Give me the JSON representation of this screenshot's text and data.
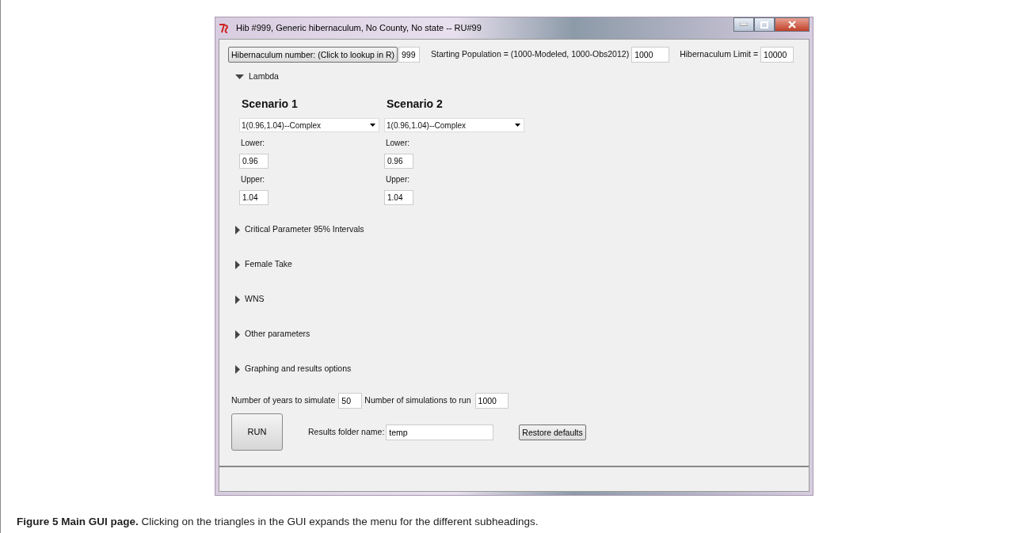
{
  "window": {
    "title": "Hib #999, Generic hibernaculum, No County, No state -- RU#99"
  },
  "top_bar": {
    "lookup_button": "Hibernaculum number: (Click to lookup in R)",
    "hib_number": "999",
    "population_label": "Starting Population = (1000-Modeled,  1000-Obs2012)",
    "population_value": "1000",
    "limit_label": "Hibernaculum Limit =",
    "limit_value": "10000"
  },
  "sections": [
    {
      "label": "Lambda",
      "expanded": true,
      "scenarios": [
        {
          "title": "Scenario 1",
          "dropdown": "1(0.96,1.04)--Complex",
          "lower_label": "Lower:",
          "lower": "0.96",
          "upper_label": "Upper:",
          "upper": "1.04"
        },
        {
          "title": "Scenario 2",
          "dropdown": "1(0.96,1.04)--Complex",
          "lower_label": "Lower:",
          "lower": "0.96",
          "upper_label": "Upper:",
          "upper": "1.04"
        }
      ]
    },
    {
      "label": "Critical Parameter 95% Intervals",
      "expanded": false
    },
    {
      "label": "Female Take",
      "expanded": false
    },
    {
      "label": "WNS",
      "expanded": false
    },
    {
      "label": "Other parameters",
      "expanded": false
    },
    {
      "label": "Graphing and results options",
      "expanded": false
    }
  ],
  "bottom": {
    "years_label": "Number of years to simulate",
    "years_value": "50",
    "sims_label": "Number of simulations to run",
    "sims_value": "1000",
    "run_button": "RUN",
    "folder_label": "Results folder name:",
    "folder_value": "temp",
    "restore_button": "Restore defaults"
  },
  "caption": "**Figure 5 Main GUI page.** Clicking on the triangles in the GUI expands the menu for the different subheadings."
}
